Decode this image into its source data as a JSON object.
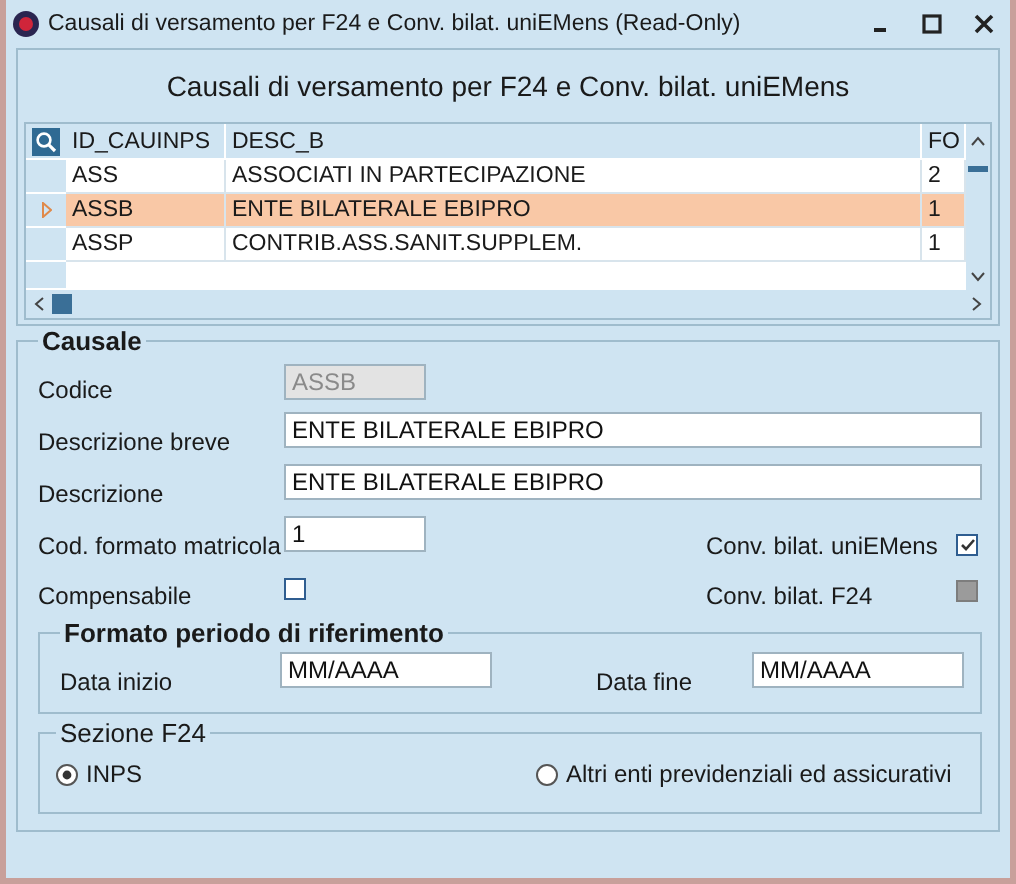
{
  "window": {
    "title": "Causali di versamento per F24 e Conv. bilat. uniEMens (Read-Only)"
  },
  "header": {
    "title": "Causali di versamento per F24 e Conv. bilat. uniEMens"
  },
  "table": {
    "columns": [
      "ID_CAUINPS",
      "DESC_B",
      "FO"
    ],
    "rows": [
      {
        "cells": [
          "ASS",
          "ASSOCIATI IN PARTECIPAZIONE",
          "2"
        ],
        "selected": false
      },
      {
        "cells": [
          "ASSB",
          "ENTE BILATERALE EBIPRO",
          "1"
        ],
        "selected": true
      },
      {
        "cells": [
          "ASSP",
          "CONTRIB.ASS.SANIT.SUPPLEM.",
          "1"
        ],
        "selected": false
      }
    ]
  },
  "causale": {
    "title": "Causale",
    "codice": {
      "label": "Codice",
      "value": "ASSB",
      "disabled": true
    },
    "descrizione_breve": {
      "label": "Descrizione breve",
      "value": "ENTE BILATERALE EBIPRO"
    },
    "descrizione": {
      "label": "Descrizione",
      "value": "ENTE BILATERALE EBIPRO"
    },
    "cod_formato": {
      "label": "Cod. formato matricola",
      "value": "1"
    },
    "compensabile": {
      "label": "Compensabile",
      "checked": false,
      "disabled": false
    },
    "conv_unimens": {
      "label": "Conv. bilat. uniEMens",
      "checked": true,
      "disabled": false
    },
    "conv_f24": {
      "label": "Conv. bilat. F24",
      "checked": false,
      "disabled": true
    }
  },
  "formato": {
    "title": "Formato periodo di riferimento",
    "data_inizio": {
      "label": "Data inizio",
      "value": "MM/AAAA"
    },
    "data_fine": {
      "label": "Data fine",
      "value": "MM/AAAA"
    }
  },
  "sezione": {
    "title": "Sezione F24",
    "options": [
      {
        "label": "INPS",
        "selected": true
      },
      {
        "label": "Altri enti previdenziali ed assicurativi",
        "selected": false
      }
    ]
  }
}
